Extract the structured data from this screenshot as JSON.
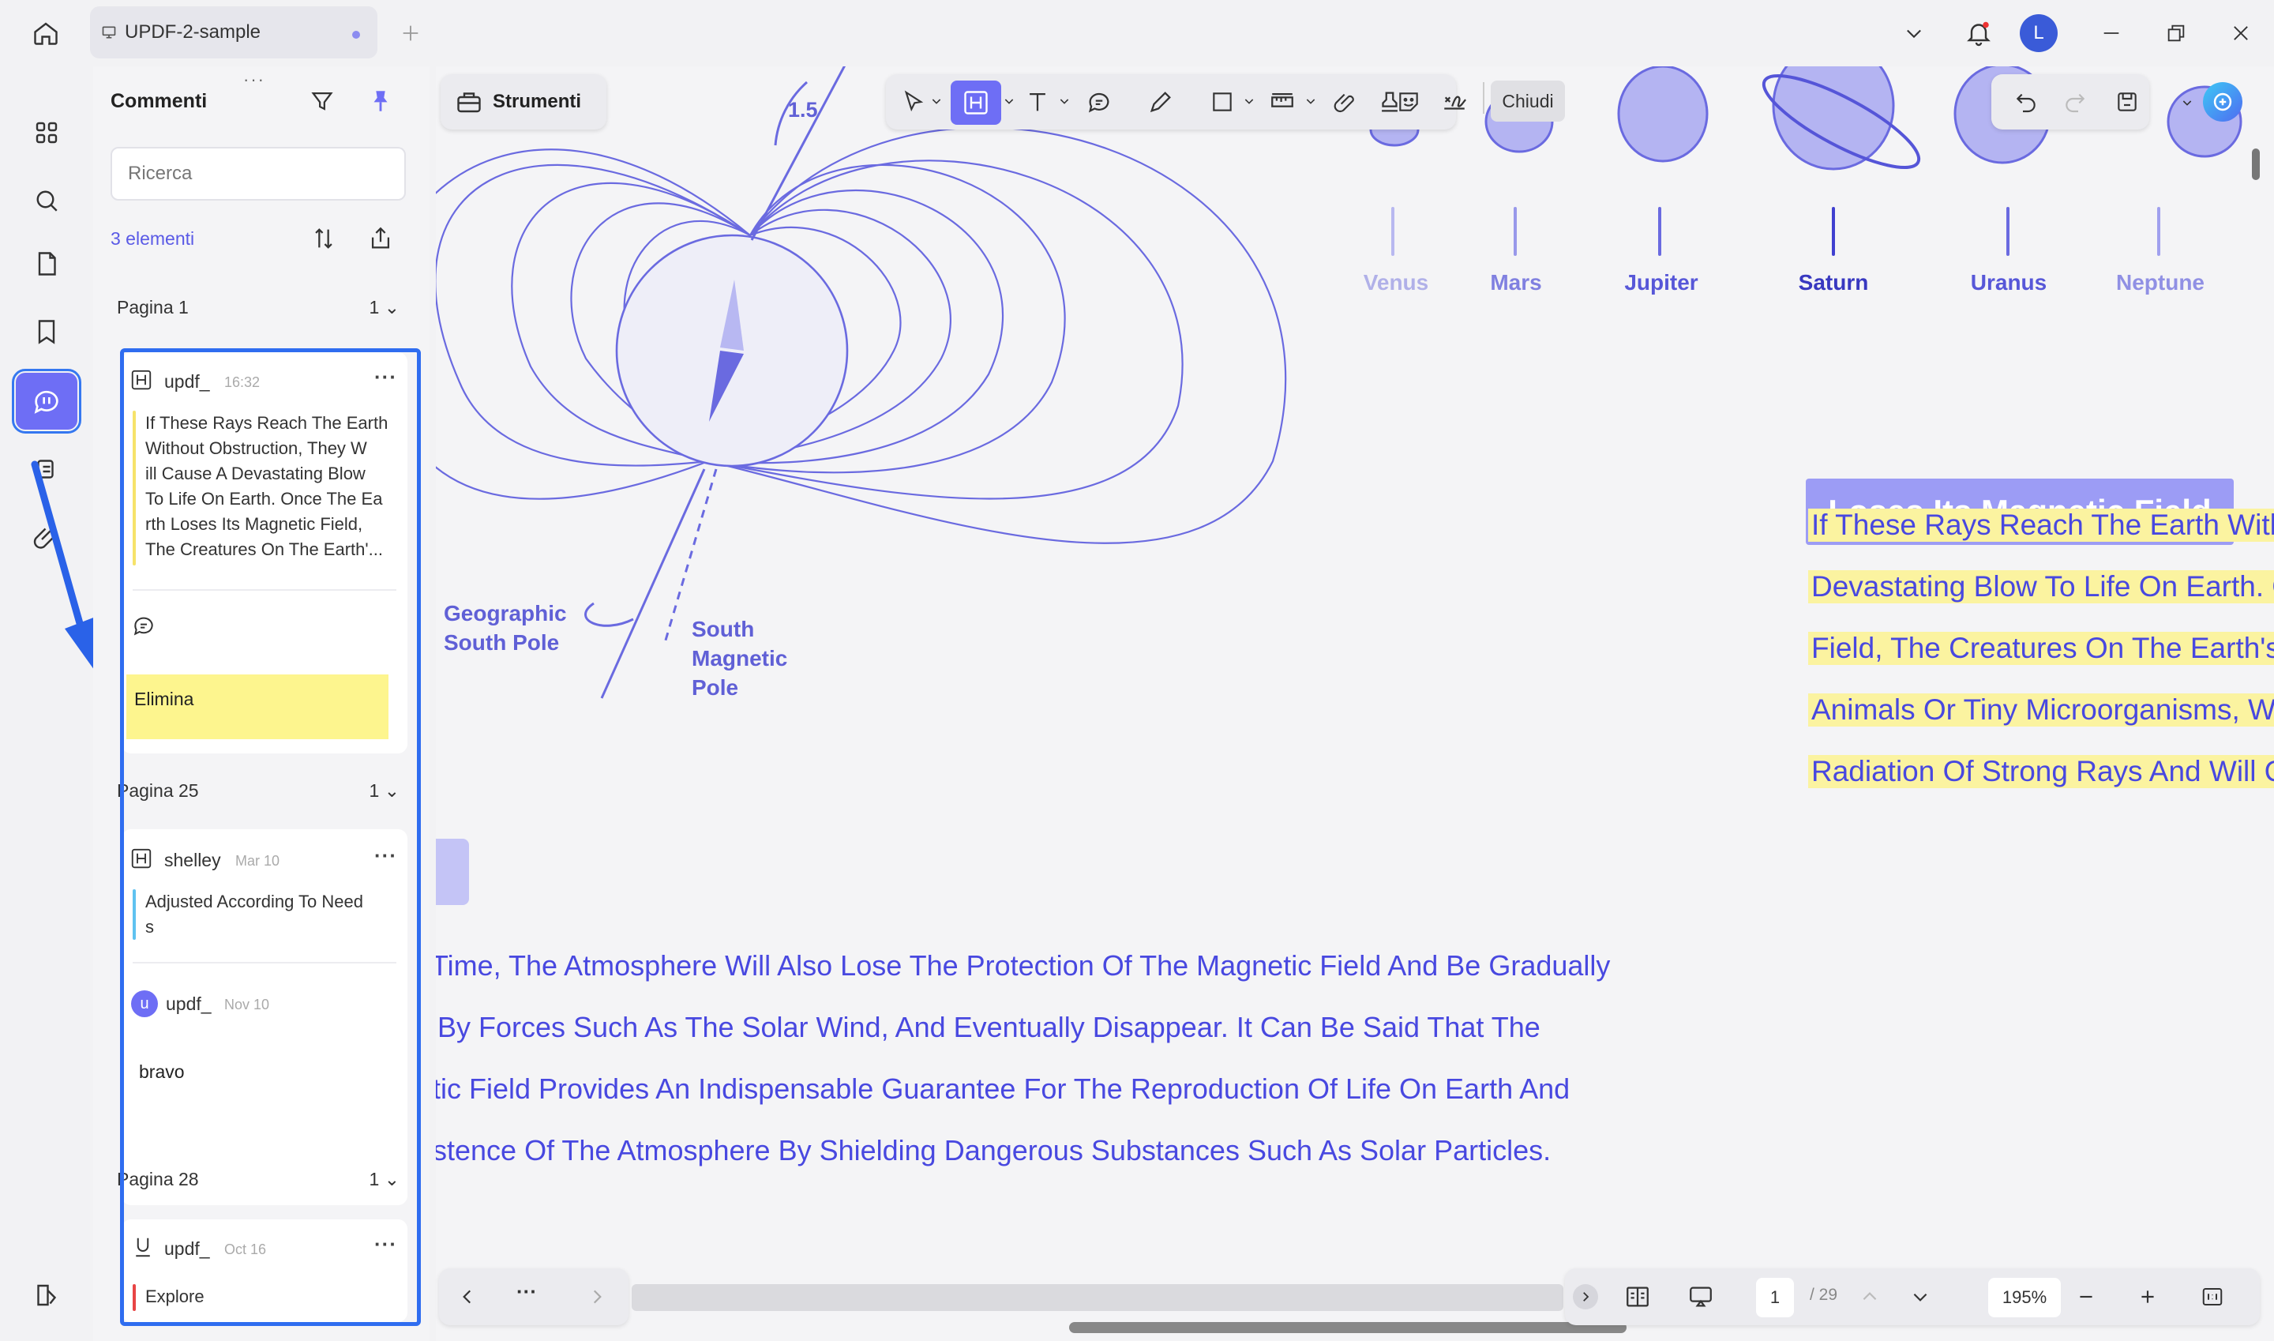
{
  "tab": {
    "title": "UPDF-2-sample"
  },
  "user": {
    "initial": "L"
  },
  "panel": {
    "title": "Commenti",
    "search_placeholder": "Ricerca",
    "count_label": "3 elementi",
    "groups": [
      {
        "page_label": "Pagina 1",
        "count": "1",
        "comment": {
          "user": "updf_",
          "time": "16:32",
          "text": "If These Rays Reach The Earth Without Obstruction, They Will Cause A Devastating Blow To Life On Earth. Once The Earth Loses Its Magnetic Field, The Creatures On The Earth'...",
          "text_lines": [
            "If These Rays Reach The Earth",
            "Without Obstruction, They W",
            "ill Cause A Devastating Blow",
            "To Life On Earth. Once The Ea",
            "rth Loses Its Magnetic Field,",
            "The Creatures On The Earth'..."
          ],
          "reply_text": "Elimina"
        }
      },
      {
        "page_label": "Pagina 25",
        "count": "1",
        "comment": {
          "user": "shelley",
          "time": "Mar 10",
          "text_lines": [
            "Adjusted According To Need",
            "s"
          ],
          "reply_user_initial": "u",
          "reply_user": "updf_",
          "reply_time": "Nov 10",
          "reply_text": "bravo"
        }
      },
      {
        "page_label": "Pagina 28",
        "count": "1",
        "comment": {
          "user": "updf_",
          "time": "Oct 16",
          "text": "Explore"
        }
      }
    ]
  },
  "toolbar": {
    "tools_label": "Strumenti",
    "close_label": "Chiudi"
  },
  "document": {
    "planets": [
      "Venus",
      "Mars",
      "Jupiter",
      "Saturn",
      "Uranus",
      "Neptune"
    ],
    "diagram": {
      "angle_label": "1.5",
      "geo_pole": [
        "Geographic",
        "South Pole"
      ],
      "mag_pole": [
        "South",
        "Magnetic",
        "Pole"
      ]
    },
    "heading": "Loses Its Magnetic Field",
    "highlighted_lines": [
      "If These Rays Reach The Earth Without Obstruction, They Will Cause A",
      "Devastating Blow To Life On Earth. Once The Earth Loses Its Magnetic",
      "Field, The Creatures On The Earth's Surface, Whether Complex Plants",
      "Animals Or Tiny Microorganisms, Will Find It Difficult To Survive Under",
      "Radiation Of Strong Rays And Will Quickly Go To Extinction."
    ],
    "body_lines": [
      "Time, The Atmosphere Will Also Lose The Protection Of The Magnetic Field And Be Gradually",
      "By Forces Such As The Solar Wind, And Eventually Disappear. It Can Be Said That The",
      "tic Field Provides An Indispensable Guarantee For The Reproduction Of Life On Earth And",
      "stence Of The Atmosphere By Shielding Dangerous Substances Such As Solar Particles."
    ]
  },
  "statusbar": {
    "current_page": "1",
    "total_pages": "/ 29",
    "zoom": "195%",
    "more": "···"
  },
  "colors": {
    "accent": "#6e6ef5",
    "highlight": "#fbf3a0",
    "selection": "#2f6df0",
    "text_blue": "#4848e0"
  }
}
